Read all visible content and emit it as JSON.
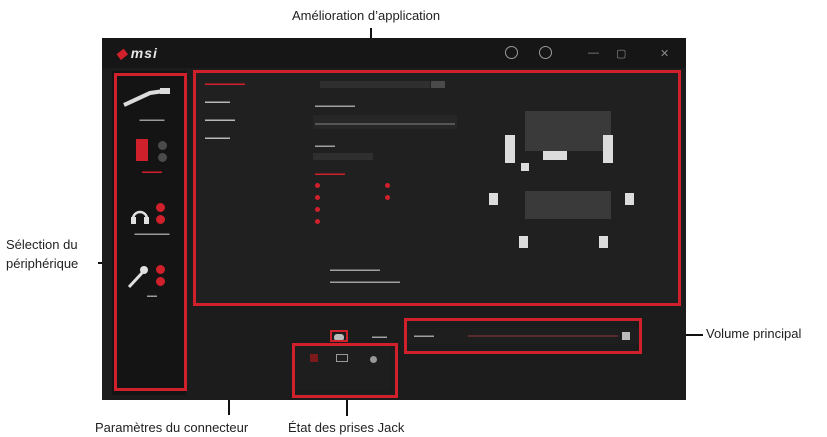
{
  "callouts": {
    "app_enhancement": "Amélioration d’application",
    "device_selection_line1": "Sélection du",
    "device_selection_line2": "périphérique",
    "main_volume": "Volume principal",
    "connector_settings": "Paramètres du connecteur",
    "jack_status": "État des prises Jack"
  },
  "colors": {
    "accent": "#d0202b",
    "window_bg": "#1c1c1c",
    "panel_bg": "#202020"
  },
  "app": {
    "logo_text": "msi",
    "icons": [
      "info-icon",
      "gear-icon",
      "minimize-icon",
      "maximize-icon",
      "close-icon"
    ]
  }
}
